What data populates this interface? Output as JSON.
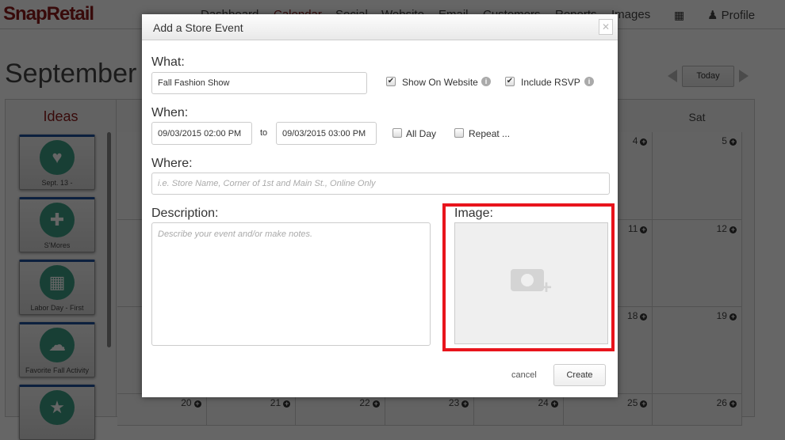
{
  "header": {
    "logo": "SnapRetail",
    "nav": [
      "Dashboard",
      "Calendar",
      "Social",
      "Website",
      "Email",
      "Customers",
      "Reports",
      "Images"
    ],
    "active": "Calendar",
    "profile": "Profile",
    "apps_icon": "grid-icon",
    "profile_icon": "user-icon"
  },
  "calendar": {
    "month": "September",
    "today_label": "Today",
    "day_headers": [
      "Sat"
    ],
    "rows": [
      [
        "",
        "",
        "",
        "",
        "",
        "4",
        "5"
      ],
      [
        "",
        "",
        "",
        "",
        "",
        "11",
        "12"
      ],
      [
        "",
        "",
        "",
        "",
        "",
        "18",
        "19"
      ],
      [
        "20",
        "21",
        "22",
        "23",
        "24",
        "25",
        "26"
      ]
    ]
  },
  "ideas": {
    "title": "Ideas",
    "items": [
      {
        "label": "Sept. 13 -",
        "icon": "heart-icon"
      },
      {
        "label": "S'Mores",
        "icon": "utensils-icon"
      },
      {
        "label": "Labor Day - First",
        "icon": "store-icon"
      },
      {
        "label": "Favorite Fall Activity",
        "icon": "weather-icon"
      },
      {
        "label": "",
        "icon": "star-icon"
      }
    ]
  },
  "dialog": {
    "title": "Add a Store Event",
    "what_label": "What:",
    "what_value": "Fall Fashion Show",
    "show_on_website": {
      "label": "Show On Website",
      "checked": true
    },
    "include_rsvp": {
      "label": "Include RSVP",
      "checked": true
    },
    "when_label": "When:",
    "start": "09/03/2015 02:00 PM",
    "to_label": "to",
    "end": "09/03/2015 03:00 PM",
    "all_day": {
      "label": "All Day",
      "checked": false
    },
    "repeat": {
      "label": "Repeat ...",
      "checked": false
    },
    "where_label": "Where:",
    "where_placeholder": "i.e. Store Name, Corner of 1st and Main St., Online Only",
    "description_label": "Description:",
    "description_placeholder": "Describe your event and/or make notes.",
    "image_label": "Image:",
    "cancel_label": "cancel",
    "create_label": "Create",
    "highlight_color": "#e8141c"
  }
}
